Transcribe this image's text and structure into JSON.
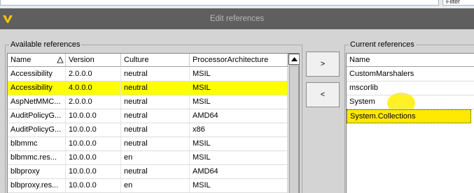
{
  "top_bar": {
    "right_field_text": "Filter"
  },
  "window": {
    "title": "Edit references"
  },
  "available": {
    "legend": "Available references",
    "columns": [
      "Name",
      "Version",
      "Culture",
      "ProcessorArchitecture"
    ],
    "rows": [
      {
        "name": "Accessibility",
        "version": "2.0.0.0",
        "culture": "neutral",
        "arch": "MSIL",
        "selected": false
      },
      {
        "name": "Accessibility",
        "version": "4.0.0.0",
        "culture": "neutral",
        "arch": "MSIL",
        "selected": true
      },
      {
        "name": "AspNetMMC...",
        "version": "2.0.0.0",
        "culture": "neutral",
        "arch": "MSIL",
        "selected": false
      },
      {
        "name": "AuditPolicyG...",
        "version": "10.0.0.0",
        "culture": "neutral",
        "arch": "AMD64",
        "selected": false
      },
      {
        "name": "AuditPolicyG...",
        "version": "10.0.0.0",
        "culture": "neutral",
        "arch": "x86",
        "selected": false
      },
      {
        "name": "blbmmc",
        "version": "10.0.0.0",
        "culture": "neutral",
        "arch": "MSIL",
        "selected": false
      },
      {
        "name": "blbmmc.res...",
        "version": "10.0.0.0",
        "culture": "en",
        "arch": "MSIL",
        "selected": false
      },
      {
        "name": "blbproxy",
        "version": "10.0.0.0",
        "culture": "neutral",
        "arch": "AMD64",
        "selected": false
      },
      {
        "name": "blbproxy.res...",
        "version": "10.0.0.0",
        "culture": "en",
        "arch": "MSIL",
        "selected": false
      }
    ]
  },
  "buttons": {
    "add_label": ">",
    "remove_label": "<"
  },
  "current": {
    "legend": "Current references",
    "column": "Name",
    "rows": [
      {
        "name": "CustomMarshalers",
        "style": "normal"
      },
      {
        "name": "mscorlib",
        "style": "normal"
      },
      {
        "name": "System",
        "style": "marker"
      },
      {
        "name": "System.Collections",
        "style": "selected"
      }
    ]
  },
  "colors": {
    "titlebar": "#5f5f5f",
    "selection": "#ffff00",
    "logo": "#f5c400"
  }
}
